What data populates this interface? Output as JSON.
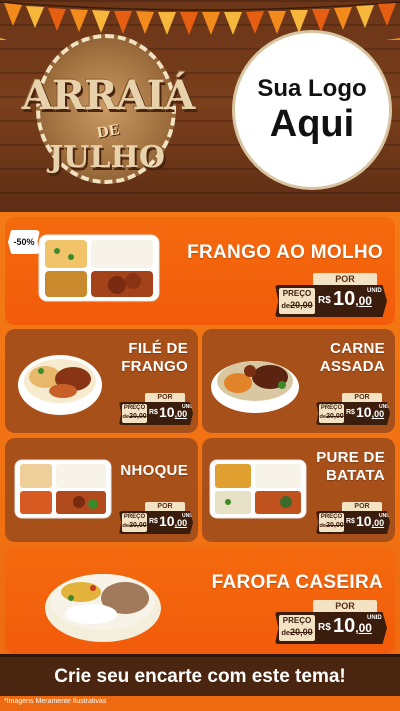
{
  "header": {
    "event_logo": {
      "line1": "ARRAIÁ",
      "line2": "DE",
      "line3": "JULHO"
    },
    "your_logo": {
      "line1": "Sua Logo",
      "line2": "Aqui"
    }
  },
  "discount_badge": "-50%",
  "products": [
    {
      "name": "FRANGO AO MOLHO",
      "por": "POR",
      "preco_label": "PREÇO",
      "old_price_prefix": "de",
      "old_price": "20,00",
      "currency": "R$",
      "price_int": "10",
      "price_cents": ",00",
      "unit": "UNID"
    },
    {
      "name_line1": "FILÉ DE",
      "name_line2": "FRANGO",
      "por": "POR",
      "preco_label": "PREÇO",
      "old_price_prefix": "de",
      "old_price": "20,00",
      "currency": "R$",
      "price_int": "10",
      "price_cents": ",00",
      "unit": "UNID"
    },
    {
      "name_line1": "CARNE",
      "name_line2": "ASSADA",
      "por": "POR",
      "preco_label": "PREÇO",
      "old_price_prefix": "de",
      "old_price": "20,00",
      "currency": "R$",
      "price_int": "10",
      "price_cents": ",00",
      "unit": "UNID"
    },
    {
      "name_line1": "NHOQUE",
      "por": "POR",
      "preco_label": "PREÇO",
      "old_price_prefix": "de",
      "old_price": "20,00",
      "currency": "R$",
      "price_int": "10",
      "price_cents": ",00",
      "unit": "UNID"
    },
    {
      "name_line1": "PURE DE",
      "name_line2": "BATATA",
      "por": "POR",
      "preco_label": "PREÇO",
      "old_price_prefix": "de",
      "old_price": "20,00",
      "currency": "R$",
      "price_int": "10",
      "price_cents": ",00",
      "unit": "UNID"
    },
    {
      "name": "FAROFA CASEIRA",
      "por": "POR",
      "preco_label": "PREÇO",
      "old_price_prefix": "de",
      "old_price": "20,00",
      "currency": "R$",
      "price_int": "10",
      "price_cents": ",00",
      "unit": "UNID"
    }
  ],
  "footer": {
    "cta": "Crie seu encarte com este tema!",
    "disclaimer": "*Imagens Meramente Ilustrativas"
  },
  "colors": {
    "orange": "#f25b0a",
    "brown_card": "#a7501a",
    "dark_brown": "#3b1d0e",
    "cream": "#f3e2c4"
  }
}
